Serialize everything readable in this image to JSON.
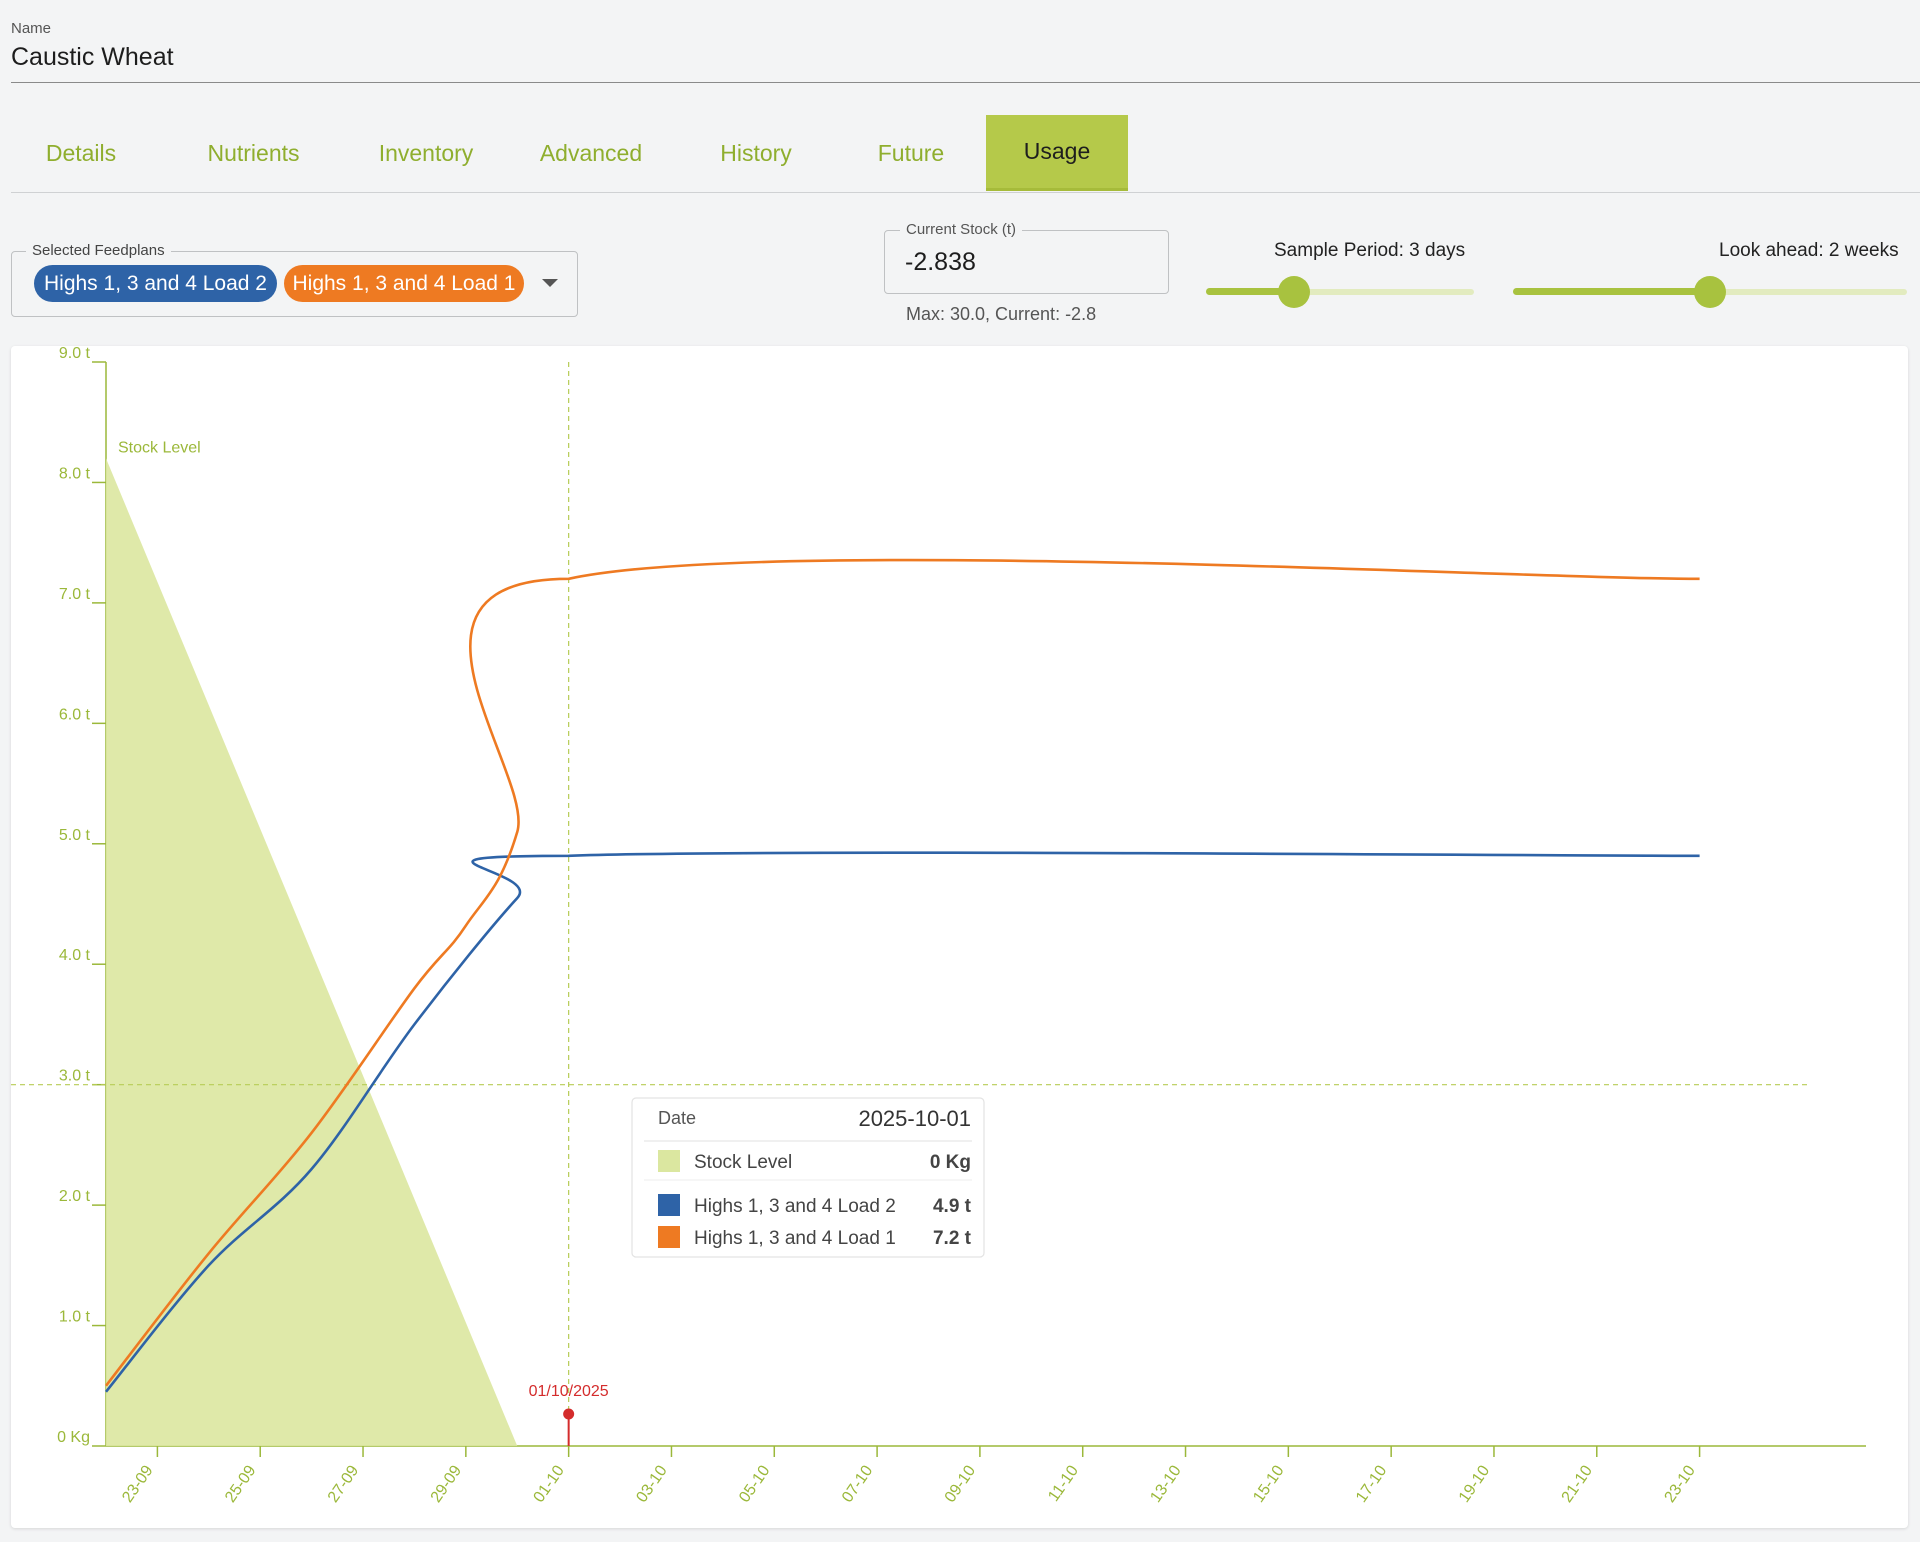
{
  "name_field": {
    "label": "Name",
    "value": "Caustic Wheat"
  },
  "tabs": [
    {
      "label": "Details",
      "active": false
    },
    {
      "label": "Nutrients",
      "active": false
    },
    {
      "label": "Inventory",
      "active": false
    },
    {
      "label": "Advanced",
      "active": false
    },
    {
      "label": "History",
      "active": false
    },
    {
      "label": "Future",
      "active": false
    },
    {
      "label": "Usage",
      "active": true
    }
  ],
  "feedplans": {
    "label": "Selected Feedplans",
    "chips": [
      "Highs 1, 3 and 4 Load 2",
      "Highs 1, 3 and 4 Load 1"
    ]
  },
  "current_stock": {
    "label": "Current Stock (t)",
    "value": "-2.838",
    "helper": "Max: 30.0, Current: -2.8"
  },
  "sample_period": {
    "label": "Sample Period: 3 days",
    "level": 0.33
  },
  "look_ahead": {
    "label": "Look ahead: 2 weeks",
    "level": 0.5
  },
  "colors": {
    "accent": "#a8c23f",
    "blue": "#2e63a7",
    "orange": "#ee7a22",
    "stock_fill": "#dbe7a0",
    "marker": "#d42c2c",
    "axis": "#9bb83a"
  },
  "chart_data": {
    "type": "line",
    "y_ticks": [
      "0 Kg",
      "1.0 t",
      "2.0 t",
      "3.0 t",
      "4.0 t",
      "5.0 t",
      "6.0 t",
      "7.0 t",
      "8.0 t",
      "9.0 t"
    ],
    "ylim": [
      0,
      9
    ],
    "x_ticks": [
      "23-09",
      "25-09",
      "27-09",
      "29-09",
      "01-10",
      "03-10",
      "05-10",
      "07-10",
      "09-10",
      "11-10",
      "13-10",
      "15-10",
      "17-10",
      "19-10",
      "21-10",
      "23-10"
    ],
    "x_range": [
      "2025-09-22",
      "2025-10-24"
    ],
    "stock_series": {
      "name": "Stock Level",
      "points": [
        [
          "2025-09-22",
          8.2
        ],
        [
          "2025-09-30",
          0
        ]
      ]
    },
    "series": [
      {
        "name": "Highs 1, 3 and 4 Load 2",
        "color": "#2e63a7",
        "points": [
          [
            "2025-09-22",
            0.45
          ],
          [
            "2025-09-24",
            1.5
          ],
          [
            "2025-09-26",
            2.3
          ],
          [
            "2025-09-28",
            3.5
          ],
          [
            "2025-09-30",
            4.55
          ],
          [
            "2025-10-01",
            4.9
          ],
          [
            "2025-10-23",
            4.9
          ]
        ]
      },
      {
        "name": "Highs 1, 3 and 4 Load 1",
        "color": "#ee7a22",
        "points": [
          [
            "2025-09-22",
            0.5
          ],
          [
            "2025-09-24",
            1.6
          ],
          [
            "2025-09-26",
            2.6
          ],
          [
            "2025-09-28",
            3.8
          ],
          [
            "2025-09-29",
            4.32
          ],
          [
            "2025-09-30",
            5.1
          ],
          [
            "2025-10-01",
            7.2
          ],
          [
            "2025-10-23",
            7.2
          ]
        ]
      }
    ],
    "marker": {
      "date": "2025-10-01",
      "label": "01/10/2025"
    },
    "crosshair_y": 3.0,
    "tooltip": {
      "date_label": "Date",
      "date_value": "2025-10-01",
      "rows": [
        {
          "label": "Stock Level",
          "value": "0 Kg",
          "color": "#dbe7a0"
        },
        {
          "label": "Highs 1, 3 and 4 Load 2",
          "value": "4.9 t",
          "color": "#2e63a7"
        },
        {
          "label": "Highs 1, 3 and 4 Load 1",
          "value": "7.2 t",
          "color": "#ee7a22"
        }
      ]
    }
  }
}
